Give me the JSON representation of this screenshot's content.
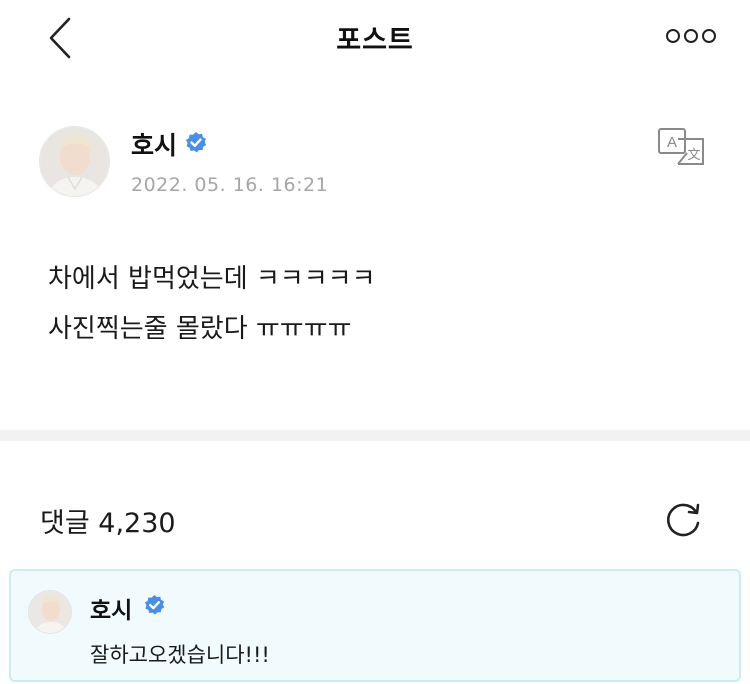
{
  "header": {
    "title": "포스트"
  },
  "post": {
    "author": "호시",
    "timestamp": "2022. 05. 16. 16:21",
    "lines": [
      "차에서 밥먹었는데 ㅋㅋㅋㅋㅋ",
      "사진찍는줄 몰랐다 ㅠㅠㅠㅠ"
    ]
  },
  "comments": {
    "label": "댓글 4,230",
    "pinned": {
      "author": "호시",
      "text": "잘하고오겠습니다!!!"
    }
  },
  "colors": {
    "verified": "#4a8fe7",
    "pinned_bg": "#f1fbfd",
    "pinned_border": "#c9edf4",
    "timestamp": "#a6a6a6",
    "divider": "#f2f2f4"
  },
  "icons": {
    "back": "chevron-left-icon",
    "more": "more-dots-icon",
    "translate": "translate-icon",
    "refresh": "refresh-icon",
    "verified": "verified-badge-icon"
  }
}
